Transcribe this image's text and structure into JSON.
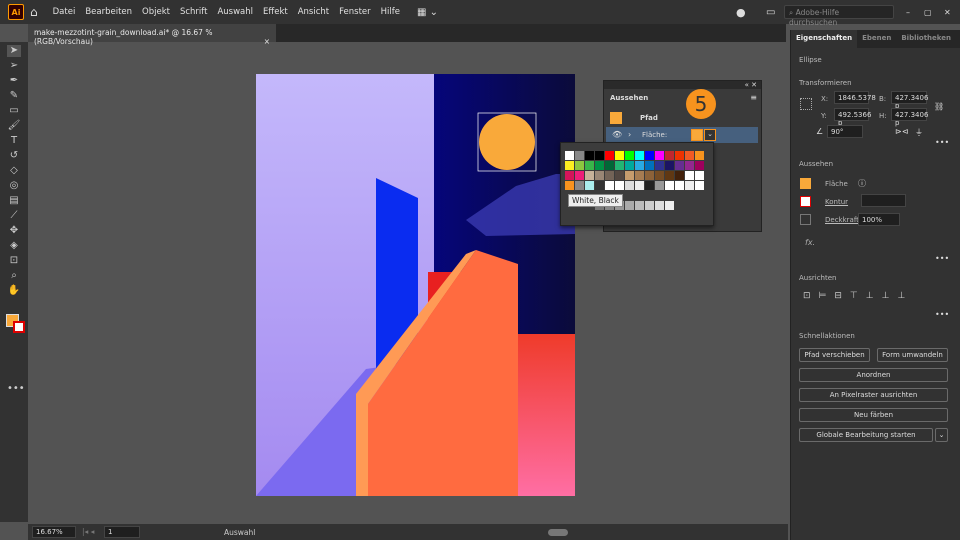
{
  "app": {
    "logo": "Ai",
    "menus": [
      "Datei",
      "Bearbeiten",
      "Objekt",
      "Schrift",
      "Auswahl",
      "Effekt",
      "Ansicht",
      "Fenster",
      "Hilfe"
    ],
    "search_placeholder": "Adobe-Hilfe durchsuchen"
  },
  "document": {
    "tab_title": "make-mezzotint-grain_download.ai* @ 16.67 % (RGB/Vorschau)",
    "close": "×"
  },
  "status": {
    "zoom": "16.67%",
    "page": "1",
    "tool": "Auswahl"
  },
  "properties": {
    "tabs": [
      "Eigenschaften",
      "Ebenen",
      "Bibliotheken"
    ],
    "object": "Ellipse",
    "transform_label": "Transformieren",
    "x_label": "X:",
    "x": "1846.5378",
    "y_label": "Y:",
    "y": "492.5366 p",
    "b_label": "B:",
    "b": "427.3406 p",
    "h_label": "H:",
    "h": "427.3406 p",
    "angle": "90°",
    "appearance_label": "Aussehen",
    "fill": "Fläche",
    "stroke": "Kontur",
    "opacity_label": "Deckkraft",
    "opacity": "100%",
    "fx": "fx.",
    "align_label": "Ausrichten",
    "quick_label": "Schnellaktionen",
    "buttons": [
      "Pfad verschieben",
      "Form umwandeln",
      "Anordnen",
      "An Pixelraster ausrichten",
      "Neu färben",
      "Globale Bearbeitung starten"
    ]
  },
  "appearance_panel": {
    "title": "Aussehen",
    "path": "Pfad",
    "fill": "Fläche:",
    "step": "5",
    "tooltip": "White, Black"
  },
  "colors": {
    "fill": "#f9a93a",
    "accent": "#f7931e"
  }
}
